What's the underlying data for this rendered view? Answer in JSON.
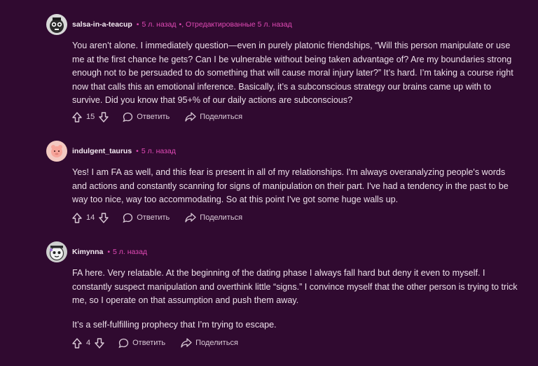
{
  "comments": [
    {
      "author": "salsa-in-a-teacup",
      "time": "5 л. назад",
      "edited": ", Отредактированные 5 л. назад",
      "paragraphs": [
        "You aren’t alone. I immediately question—even in purely platonic friendships, “Will this person manipulate or use me at the first chance he gets? Can I be vulnerable without being taken advantage of? Are my boundaries strong enough not to be persuaded to do something that will cause moral injury later?” It’s hard. I’m taking a course right now that calls this an emotional inference. Basically, it’s a subconscious strategy our brains came up with to survive. Did you know that 95+% of our daily actions are subconscious?"
      ],
      "votes": "15",
      "reply_label": "Ответить",
      "share_label": "Поделиться"
    },
    {
      "author": "indulgent_taurus",
      "time": "5 л. назад",
      "paragraphs": [
        "Yes! I am FA as well, and this fear is present in all of my relationships. I'm always overanalyzing people's words and actions and constantly scanning for signs of manipulation on their part. I've had a tendency in the past to be way too nice, way too accommodating. So at this point I've got some huge walls up."
      ],
      "votes": "14",
      "reply_label": "Ответить",
      "share_label": "Поделиться"
    },
    {
      "author": "Kimynna",
      "time": "5 л. назад",
      "paragraphs": [
        "FA here. Very relatable. At the beginning of the dating phase I always fall hard but deny it even to myself. I constantly suspect manipulation and overthink little “signs.” I convince myself that the other person is trying to trick me, so I operate on that assumption and push them away.",
        "It’s a self-fulfilling prophecy that I’m trying to escape."
      ],
      "votes": "4",
      "reply_label": "Ответить",
      "share_label": "Поделиться"
    }
  ],
  "colors": {
    "background": "#300a30",
    "accent": "#e24ab6",
    "text": "#ecdfe9"
  },
  "icons": [
    "upvote-icon",
    "downvote-icon",
    "comment-icon",
    "share-icon"
  ]
}
